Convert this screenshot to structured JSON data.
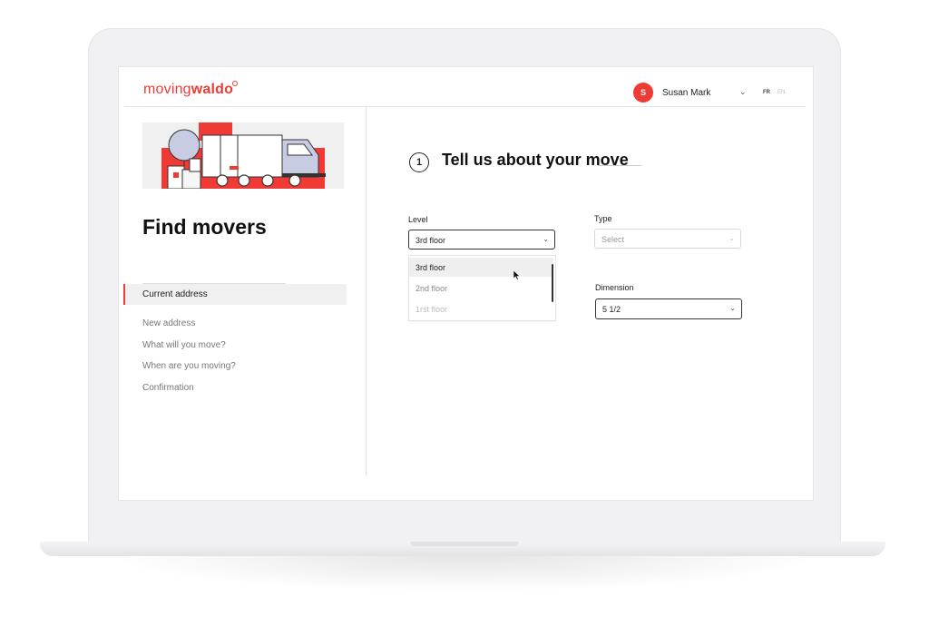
{
  "brand": {
    "prefix": "moving",
    "name": "waldo",
    "accent": "#ef3a35"
  },
  "user": {
    "initial": "S",
    "name": "Susan Mark"
  },
  "languages": {
    "active": "FR",
    "inactive": "EN"
  },
  "sidebar": {
    "title": "Find movers",
    "active_item": "Current address",
    "items": [
      "New address",
      "What will you move?",
      "When are you moving?",
      "Confirmation"
    ]
  },
  "step": {
    "number": "1",
    "title": "Tell us about your move"
  },
  "form": {
    "level": {
      "label": "Level",
      "value": "3rd floor",
      "options": [
        "3rd floor",
        "2nd floor",
        "1rst floor"
      ]
    },
    "type": {
      "label": "Type",
      "placeholder": "Select"
    },
    "dimension": {
      "label": "Dimension",
      "value": "5 1/2"
    }
  },
  "icons": {
    "chevron": "chevron-down-icon",
    "cursor": "mouse-pointer-icon"
  }
}
